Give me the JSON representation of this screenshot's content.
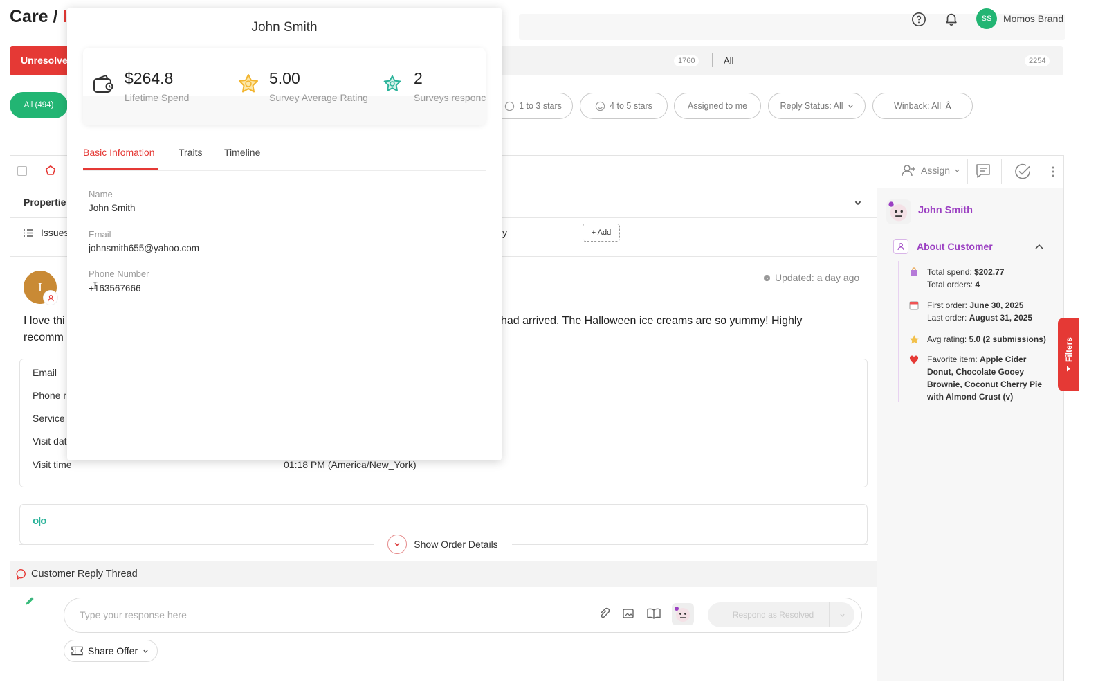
{
  "header": {
    "title_prefix": "Care /",
    "title_suffix": "I",
    "help_icon": "help-circle-icon",
    "bell_icon": "bell-icon",
    "avatar_initials": "SS",
    "brand": "Momos Brand"
  },
  "tabs": {
    "unresolved_label": "Unresolve",
    "count_a": "1760",
    "all_label": "All",
    "count_b": "2254"
  },
  "filters": {
    "all": "All (494)",
    "one_to_three": "1 to 3 stars",
    "four_to_five": "4 to 5 stars",
    "assigned": "Assigned to me",
    "reply_status": "Reply Status: All",
    "winback": "Winback: All"
  },
  "ticket": {
    "properties_label": "Propertie",
    "issues_label": "Issues",
    "partial_y": "y",
    "add_button": "+ Add",
    "avatar_letter": "I",
    "updated": "Updated: a day ago",
    "review_line1_left": "I love thi",
    "review_line1_right": "had arrived. The Halloween ice creams are so yummy! Highly",
    "review_line2_left": "recomm",
    "details": {
      "email": "Email",
      "phone": "Phone r",
      "service": "Service",
      "visit_date": "Visit dat",
      "visit_time": "Visit time",
      "visit_time_value": "01:18 PM (America/New_York)"
    },
    "show_order_details": "Show Order Details",
    "reply_thread": "Customer Reply Thread",
    "response_placeholder": "Type your response here",
    "respond_button": "Respond as Resolved",
    "share_offer": "Share Offer"
  },
  "toolbar": {
    "assign": "Assign"
  },
  "sidebar": {
    "customer_name": "John Smith",
    "about_title": "About Customer",
    "total_spend_label": "Total spend:",
    "total_spend": "$202.77",
    "total_orders_label": "Total orders:",
    "total_orders": "4",
    "first_order_label": "First order:",
    "first_order": "June 30, 2025",
    "last_order_label": "Last order:",
    "last_order": "August 31, 2025",
    "avg_rating_label": "Avg rating:",
    "avg_rating": "5.0 (2 submissions)",
    "favorite_label": "Favorite item:",
    "favorite_l1": "Apple Cider",
    "favorite_l2": "Donut, Chocolate Gooey",
    "favorite_l3": "Brownie, Coconut Cherry Pie",
    "favorite_l4": "with Almond Crust (v)",
    "filters_tab": "Filters"
  },
  "popup": {
    "name": "John Smith",
    "lifetime_spend": "$264.8",
    "lifetime_spend_label": "Lifetime Spend",
    "survey_rating": "5.00",
    "survey_rating_label": "Survey Average Rating",
    "surveys_count": "2",
    "surveys_label": "Surveys responc",
    "tabs": [
      "Basic Infomation",
      "Traits",
      "Timeline"
    ],
    "name_label": "Name",
    "name_value": "John Smith",
    "email_label": "Email",
    "email_value": "johnsmith655@yahoo.com",
    "phone_label": "Phone Number",
    "phone_value": "+163567666"
  },
  "colors": {
    "brand_red": "#e53935",
    "green": "#22b573",
    "purple": "#9b3fc2",
    "teal": "#2bb39a",
    "gold": "#f2b530"
  }
}
